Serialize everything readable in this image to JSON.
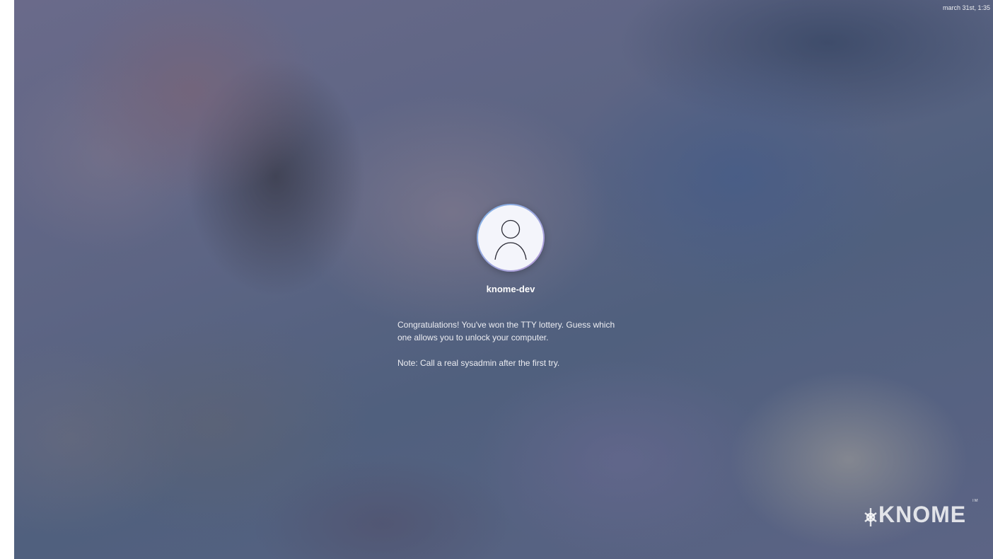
{
  "top_bar": {
    "clock_text": "march 31st, 1:35"
  },
  "login": {
    "avatar_icon": "user-icon",
    "username": "knome-dev",
    "message_line": "Congratulations! You've won the TTY lottery. Guess which one allows you to unlock your computer.",
    "note_line": "Note: Call a real sysadmin after the first try."
  },
  "branding": {
    "logo_text": "KNOME",
    "trademark": "TM",
    "logo_icon": "gear-icon"
  },
  "colors": {
    "avatar_ring_start": "#7fb4e8",
    "avatar_ring_end": "#b79ad6",
    "avatar_fill": "#f4f5fb",
    "text": "#ffffff"
  }
}
